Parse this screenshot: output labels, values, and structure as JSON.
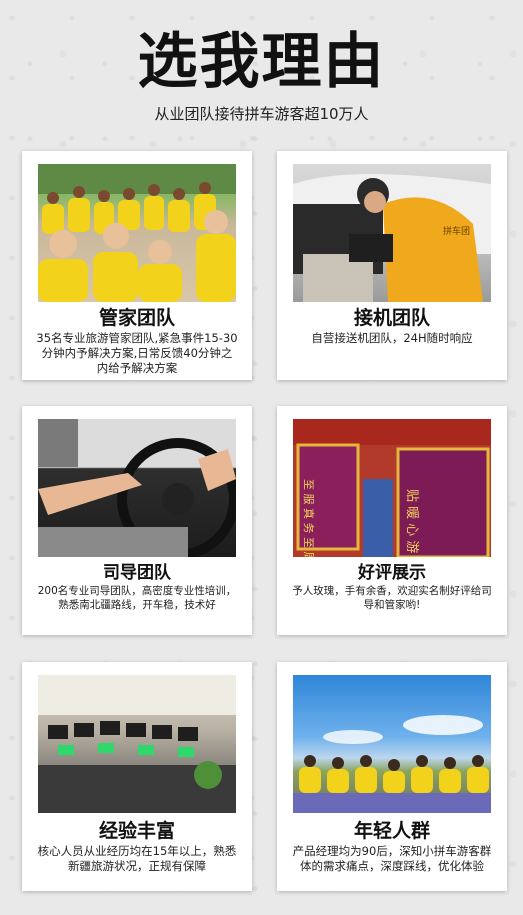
{
  "header": {
    "title": "选我理由",
    "subtitle": "从业团队接待拼车游客超10万人"
  },
  "cards": [
    {
      "icon": "team-photo",
      "title": "管家团队",
      "desc": "35名专业旅游管家团队,紧急事件15-30分钟内予解决方案,日常反馈40分钟之内给予解决方案"
    },
    {
      "icon": "pickup-photo",
      "title": "接机团队",
      "desc": "自营接送机团队，24H随时响应"
    },
    {
      "icon": "steering-wheel-photo",
      "title": "司导团队",
      "desc": "200名专业司导团队，高密度专业性培训，熟悉南北疆路线，开车稳，技术好"
    },
    {
      "icon": "banner-photo",
      "title": "好评展示",
      "desc": "予人玫瑰，手有余香，欢迎实名制好评给司导和管家哟!"
    },
    {
      "icon": "office-photo",
      "title": "经验丰富",
      "desc": "核心人员从业经历均在15年以上，熟悉新疆旅游状况，正规有保障"
    },
    {
      "icon": "young-group-photo",
      "title": "年轻人群",
      "desc": "产品经理均为90后，深知小拼车游客群体的需求痛点，深度踩线，优化体验"
    }
  ],
  "photo_text": {
    "banner_left": "至 服 真 务 至 周 诚 到",
    "banner_right": "贴 暖 心 游 服 客 务",
    "vest_text": "拼车团"
  }
}
